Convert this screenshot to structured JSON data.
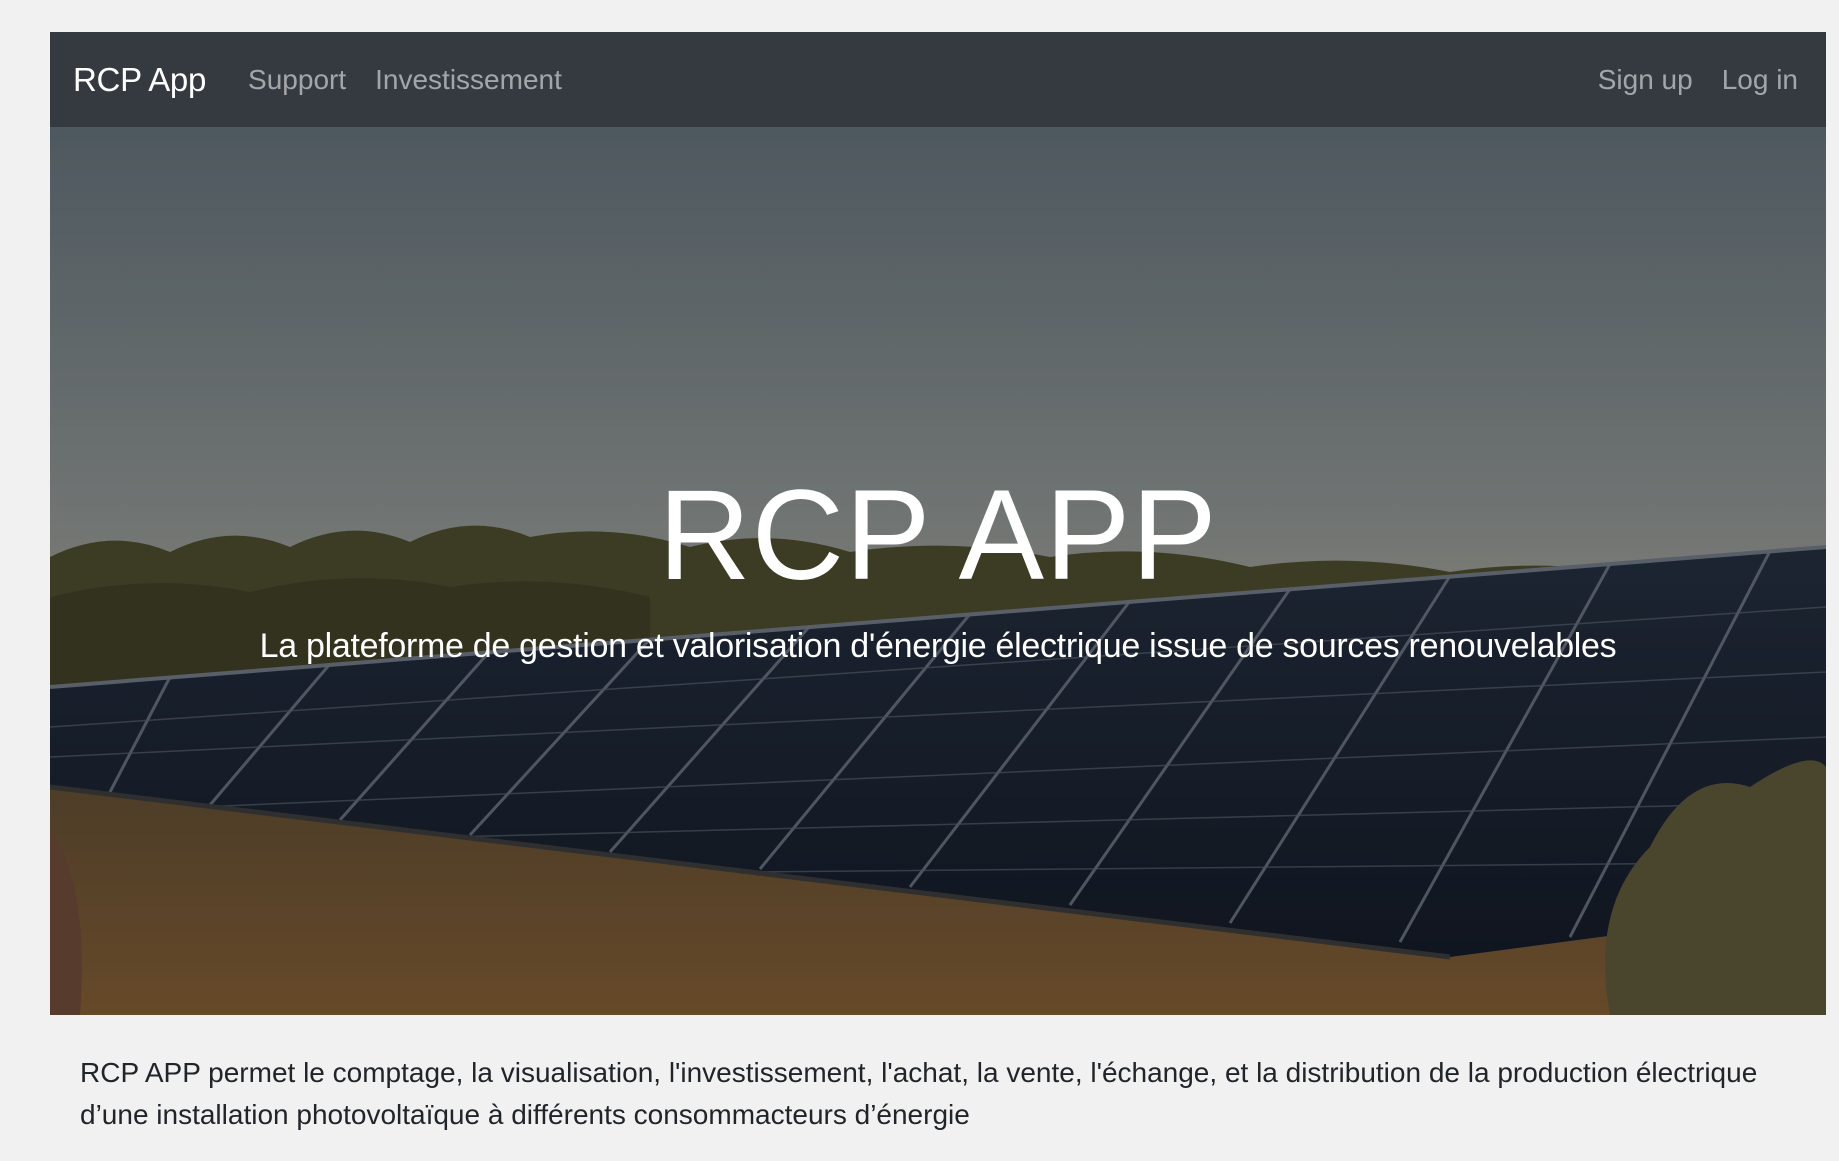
{
  "navbar": {
    "brand": "RCP App",
    "links": [
      "Support",
      "Investissement"
    ],
    "right_links": [
      "Sign up",
      "Log in"
    ],
    "background": "#343a40"
  },
  "hero": {
    "title": "RCP APP",
    "subtitle": "La plateforme de gestion et valorisation d'énergie électrique issue de sources renouvelables",
    "image": "solar-panel-field-photo"
  },
  "description": {
    "text": "RCP APP permet le comptage, la visualisation, l'investissement, l'achat, la vente, l'échange, et la distribution de la production électrique d’une installation photovoltaïque à différents consommacteurs d’énergie"
  }
}
